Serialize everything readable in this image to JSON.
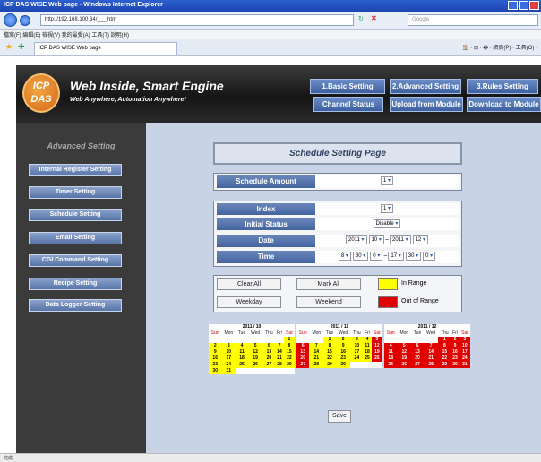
{
  "window": {
    "title": "ICP DAS WISE Web page - Windows Internet Explorer"
  },
  "browser": {
    "url": "http://192.168.100.34/___.htm",
    "search_placeholder": "Google",
    "menu": "檔案(F)  編輯(E)  檢視(V)  我的最愛(A)  工具(T)  說明(H)",
    "tab_label": "ICP DAS WISE Web page",
    "tools": "🏠 · ⊡ · 🖶 · 網頁(P) · 工具(O) ·",
    "status": "完成"
  },
  "header": {
    "logo_text": "ICP DAS",
    "brand": "Web Inside, Smart Engine",
    "tagline": "Web Anywhere, Automation Anywhere!"
  },
  "top_buttons": {
    "basic": "1.Basic Setting",
    "advanced": "2.Advanced Setting",
    "rules": "3.Rules Setting",
    "channel": "Channel Status",
    "upload": "Upload from Module",
    "download": "Download to Module"
  },
  "sidebar": {
    "title": "Advanced Setting",
    "items": [
      "Internal Register Setting",
      "Timer Setting",
      "Schedule Setting",
      "Email Setting",
      "CGI Command Setting",
      "Recipe Setting",
      "Data Logger Setting"
    ]
  },
  "page": {
    "title": "Schedule Setting Page",
    "amount_label": "Schedule Amount",
    "amount_value": "1",
    "index_label": "Index",
    "index_value": "1",
    "status_label": "Initial Status",
    "status_value": "Disable",
    "date_label": "Date",
    "date_start_year": "2011",
    "date_start_month": "10",
    "date_sep": "~",
    "date_end_year": "2011",
    "date_end_month": "12",
    "time_label": "Time",
    "time_sh": "8",
    "time_sm": "30",
    "time_ss": "0",
    "time_sep": "~",
    "time_eh": "17",
    "time_em": "30",
    "time_es": "0",
    "btn_clear": "Clear All",
    "btn_mark": "Mark All",
    "in_range": "In Range",
    "btn_weekday": "Weekday",
    "btn_weekend": "Weekend",
    "out_range": "Out of Range",
    "save": "Save"
  },
  "colors": {
    "in_range": "#ffff00",
    "out_range": "#e00000"
  },
  "calendars": [
    {
      "title": "2011 / 10",
      "weekdays": [
        "Sun",
        "Mon",
        "Tue",
        "Wed",
        "Thu",
        "Fri",
        "Sat"
      ],
      "weeks": [
        [
          "",
          "",
          "",
          "",
          "",
          "",
          "1"
        ],
        [
          "2",
          "3",
          "4",
          "5",
          "6",
          "7",
          "8"
        ],
        [
          "9",
          "10",
          "11",
          "12",
          "13",
          "14",
          "15"
        ],
        [
          "16",
          "17",
          "18",
          "19",
          "20",
          "21",
          "22"
        ],
        [
          "23",
          "24",
          "25",
          "26",
          "27",
          "28",
          "29"
        ],
        [
          "30",
          "31",
          "",
          "",
          "",
          "",
          ""
        ]
      ],
      "marks": [
        [
          "",
          "",
          "",
          "",
          "",
          "",
          "y"
        ],
        [
          "y",
          "y",
          "y",
          "y",
          "y",
          "y",
          "y"
        ],
        [
          "y",
          "y",
          "y",
          "y",
          "y",
          "y",
          "y"
        ],
        [
          "y",
          "y",
          "y",
          "y",
          "y",
          "y",
          "y"
        ],
        [
          "y",
          "y",
          "y",
          "y",
          "y",
          "y",
          "y"
        ],
        [
          "y",
          "y",
          "",
          "",
          "",
          "",
          ""
        ]
      ]
    },
    {
      "title": "2011 / 11",
      "weekdays": [
        "Sun",
        "Mon",
        "Tue",
        "Wed",
        "Thu",
        "Fri",
        "Sat"
      ],
      "weeks": [
        [
          "",
          "",
          "1",
          "2",
          "3",
          "4",
          "5"
        ],
        [
          "6",
          "7",
          "8",
          "9",
          "10",
          "11",
          "12"
        ],
        [
          "13",
          "14",
          "15",
          "16",
          "17",
          "18",
          "19"
        ],
        [
          "20",
          "21",
          "22",
          "23",
          "24",
          "25",
          "26"
        ],
        [
          "27",
          "28",
          "29",
          "30",
          "",
          "",
          ""
        ]
      ],
      "marks": [
        [
          "",
          "",
          "y",
          "y",
          "y",
          "y",
          "r"
        ],
        [
          "r",
          "y",
          "y",
          "y",
          "y",
          "y",
          "r"
        ],
        [
          "r",
          "y",
          "y",
          "y",
          "y",
          "y",
          "r"
        ],
        [
          "r",
          "y",
          "y",
          "y",
          "y",
          "y",
          "r"
        ],
        [
          "r",
          "y",
          "y",
          "y",
          "",
          "",
          ""
        ]
      ]
    },
    {
      "title": "2011 / 12",
      "weekdays": [
        "Sun",
        "Mon",
        "Tue",
        "Wed",
        "Thu",
        "Fri",
        "Sat"
      ],
      "weeks": [
        [
          "",
          "",
          "",
          "",
          "1",
          "2",
          "3"
        ],
        [
          "4",
          "5",
          "6",
          "7",
          "8",
          "9",
          "10"
        ],
        [
          "11",
          "12",
          "13",
          "14",
          "15",
          "16",
          "17"
        ],
        [
          "18",
          "19",
          "20",
          "21",
          "22",
          "23",
          "24"
        ],
        [
          "25",
          "26",
          "27",
          "28",
          "29",
          "30",
          "31"
        ]
      ],
      "marks": [
        [
          "",
          "",
          "",
          "",
          "r",
          "r",
          "r"
        ],
        [
          "r",
          "r",
          "r",
          "r",
          "r",
          "r",
          "r"
        ],
        [
          "r",
          "r",
          "r",
          "r",
          "r",
          "r",
          "r"
        ],
        [
          "r",
          "r",
          "r",
          "r",
          "r",
          "r",
          "r"
        ],
        [
          "r",
          "r",
          "r",
          "r",
          "r",
          "r",
          "r"
        ]
      ]
    }
  ]
}
